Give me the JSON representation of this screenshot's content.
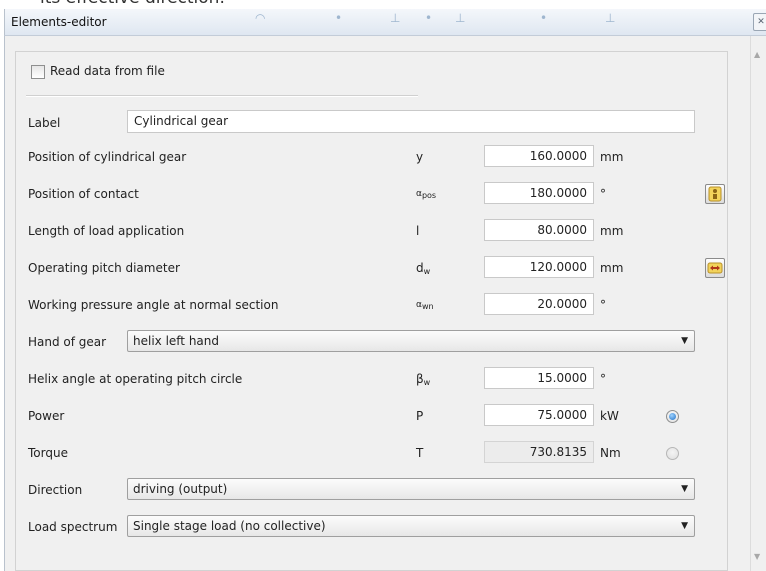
{
  "top_strip": {
    "text": "its effective direction."
  },
  "window": {
    "title": "Elements-editor"
  },
  "read_file": {
    "label": "Read data from file",
    "checked": false
  },
  "label_field": {
    "label": "Label",
    "value": "Cylindrical gear"
  },
  "rows": {
    "position": {
      "label": "Position of cylindrical gear",
      "symbol": "y",
      "value": "160.0000",
      "unit": "mm"
    },
    "contact": {
      "label": "Position of contact",
      "symbol_main": "α",
      "symbol_sub": "pos",
      "value": "180.0000",
      "unit": "°"
    },
    "length": {
      "label": "Length of load application",
      "symbol": "l",
      "value": "80.0000",
      "unit": "mm"
    },
    "diameter": {
      "label": "Operating pitch diameter",
      "symbol_main": "d",
      "symbol_sub": "w",
      "value": "120.0000",
      "unit": "mm"
    },
    "pressure": {
      "label": "Working pressure angle at normal section",
      "symbol_main": "α",
      "symbol_sub": "wn",
      "value": "20.0000",
      "unit": "°"
    },
    "helix": {
      "label": "Helix angle at operating pitch circle",
      "symbol_main": "β",
      "symbol_sub": "w",
      "value": "15.0000",
      "unit": "°"
    },
    "power": {
      "label": "Power",
      "symbol": "P",
      "value": "75.0000",
      "unit": "kW",
      "selected": true
    },
    "torque": {
      "label": "Torque",
      "symbol": "T",
      "value": "730.8135",
      "unit": "Nm",
      "selected": false
    }
  },
  "hand": {
    "label": "Hand of gear",
    "selected": "helix left hand"
  },
  "direction": {
    "label": "Direction",
    "selected": "driving (output)"
  },
  "load_spectrum": {
    "label": "Load spectrum",
    "selected": "Single stage load (no collective)"
  },
  "icons": {
    "info": "info-person-icon",
    "exchange": "swap-arrows-icon"
  }
}
